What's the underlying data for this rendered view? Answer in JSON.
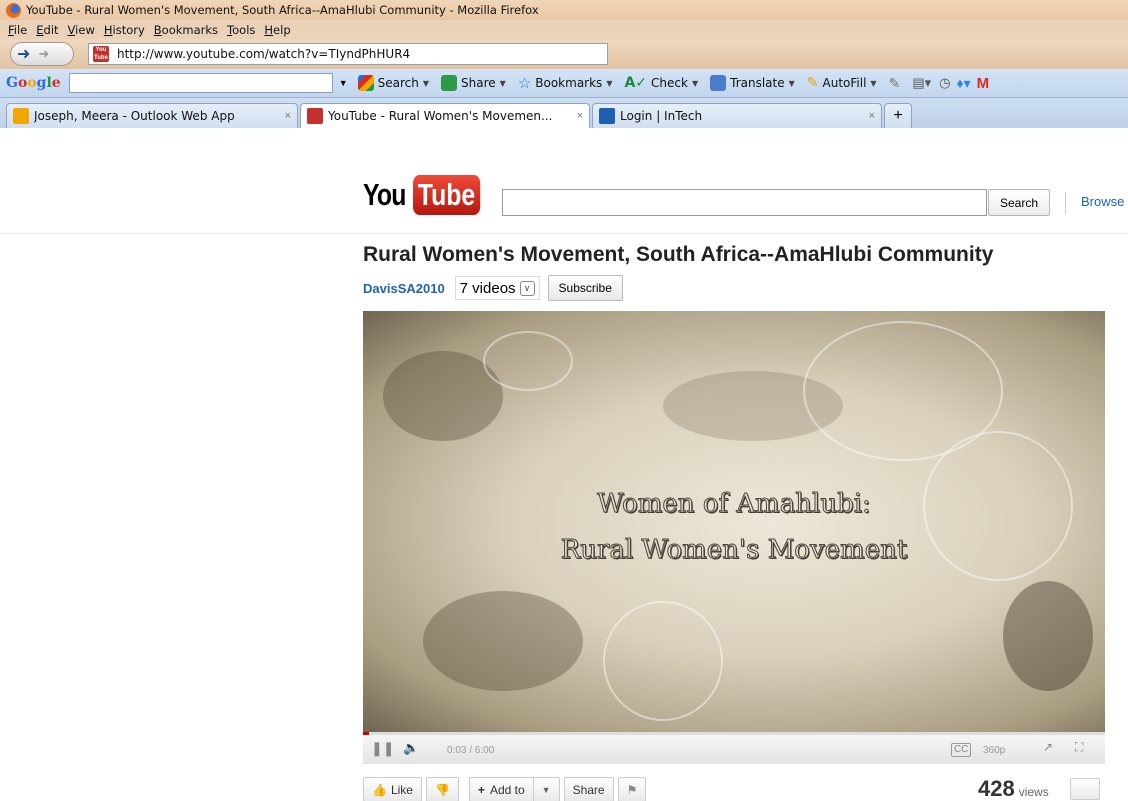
{
  "window": {
    "title": "YouTube - Rural Women's Movement, South Africa--AmaHlubi Community - Mozilla Firefox"
  },
  "menu": [
    "File",
    "Edit",
    "View",
    "History",
    "Bookmarks",
    "Tools",
    "Help"
  ],
  "address_bar": {
    "url": "http://www.youtube.com/watch?v=TIyndPhHUR4"
  },
  "google_toolbar": {
    "logo": "Google",
    "search_value": "",
    "buttons": {
      "search": "Search",
      "share": "Share",
      "bookmarks": "Bookmarks",
      "check": "Check",
      "translate": "Translate",
      "autofill": "AutoFill"
    }
  },
  "tabs": [
    {
      "label": "Joseph, Meera - Outlook Web App",
      "active": false
    },
    {
      "label": "YouTube - Rural Women's Movemen...",
      "active": true
    },
    {
      "label": "Login | InTech",
      "active": false
    }
  ],
  "youtube": {
    "logo_you": "You",
    "logo_tube": "Tube",
    "search_value": "",
    "search_button": "Search",
    "browse": "Browse",
    "video_title": "Rural Women's Movement, South Africa--AmaHlubi Community",
    "channel": "DavisSA2010",
    "videos_count": "7 videos",
    "subscribe": "Subscribe",
    "player": {
      "line1": "Women of Amahlubi:",
      "line2": "Rural Women's Movement",
      "time": "0:03 / 6:00",
      "quality": "360p",
      "progress": 0.008
    },
    "actions": {
      "like": "Like",
      "add_to": "Add to",
      "share": "Share"
    },
    "views_count": "428",
    "views_label": "views"
  },
  "colors": {
    "link": "#1c62b9",
    "youtube_red": "#c4302b",
    "progress": "#cc0000"
  }
}
